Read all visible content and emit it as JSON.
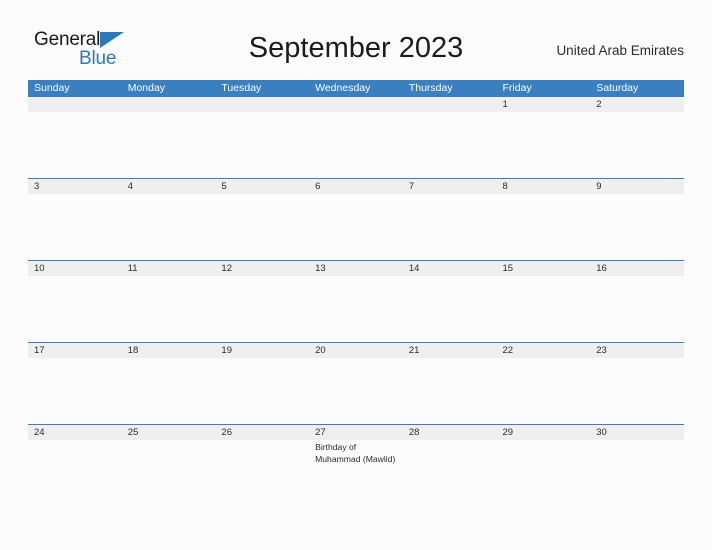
{
  "brand": {
    "name_part1": "General",
    "name_part2": "Blue",
    "triangle_icon": "blue-triangle-icon",
    "accent_color": "#2a7ab9"
  },
  "header": {
    "title": "September 2023",
    "region": "United Arab Emirates",
    "header_bar_color": "#3a7fbf",
    "date_band_color": "#efeff0"
  },
  "calendar": {
    "month": "September",
    "year": "2023",
    "weekdays": [
      "Sunday",
      "Monday",
      "Tuesday",
      "Wednesday",
      "Thursday",
      "Friday",
      "Saturday"
    ],
    "weeks": [
      {
        "days": [
          {
            "num": "",
            "event": ""
          },
          {
            "num": "",
            "event": ""
          },
          {
            "num": "",
            "event": ""
          },
          {
            "num": "",
            "event": ""
          },
          {
            "num": "",
            "event": ""
          },
          {
            "num": "1",
            "event": ""
          },
          {
            "num": "2",
            "event": ""
          }
        ]
      },
      {
        "days": [
          {
            "num": "3",
            "event": ""
          },
          {
            "num": "4",
            "event": ""
          },
          {
            "num": "5",
            "event": ""
          },
          {
            "num": "6",
            "event": ""
          },
          {
            "num": "7",
            "event": ""
          },
          {
            "num": "8",
            "event": ""
          },
          {
            "num": "9",
            "event": ""
          }
        ]
      },
      {
        "days": [
          {
            "num": "10",
            "event": ""
          },
          {
            "num": "11",
            "event": ""
          },
          {
            "num": "12",
            "event": ""
          },
          {
            "num": "13",
            "event": ""
          },
          {
            "num": "14",
            "event": ""
          },
          {
            "num": "15",
            "event": ""
          },
          {
            "num": "16",
            "event": ""
          }
        ]
      },
      {
        "days": [
          {
            "num": "17",
            "event": ""
          },
          {
            "num": "18",
            "event": ""
          },
          {
            "num": "19",
            "event": ""
          },
          {
            "num": "20",
            "event": ""
          },
          {
            "num": "21",
            "event": ""
          },
          {
            "num": "22",
            "event": ""
          },
          {
            "num": "23",
            "event": ""
          }
        ]
      },
      {
        "days": [
          {
            "num": "24",
            "event": ""
          },
          {
            "num": "25",
            "event": ""
          },
          {
            "num": "26",
            "event": ""
          },
          {
            "num": "27",
            "event": "Birthday of Muhammad (Mawlid)"
          },
          {
            "num": "28",
            "event": ""
          },
          {
            "num": "29",
            "event": ""
          },
          {
            "num": "30",
            "event": ""
          }
        ]
      }
    ]
  }
}
